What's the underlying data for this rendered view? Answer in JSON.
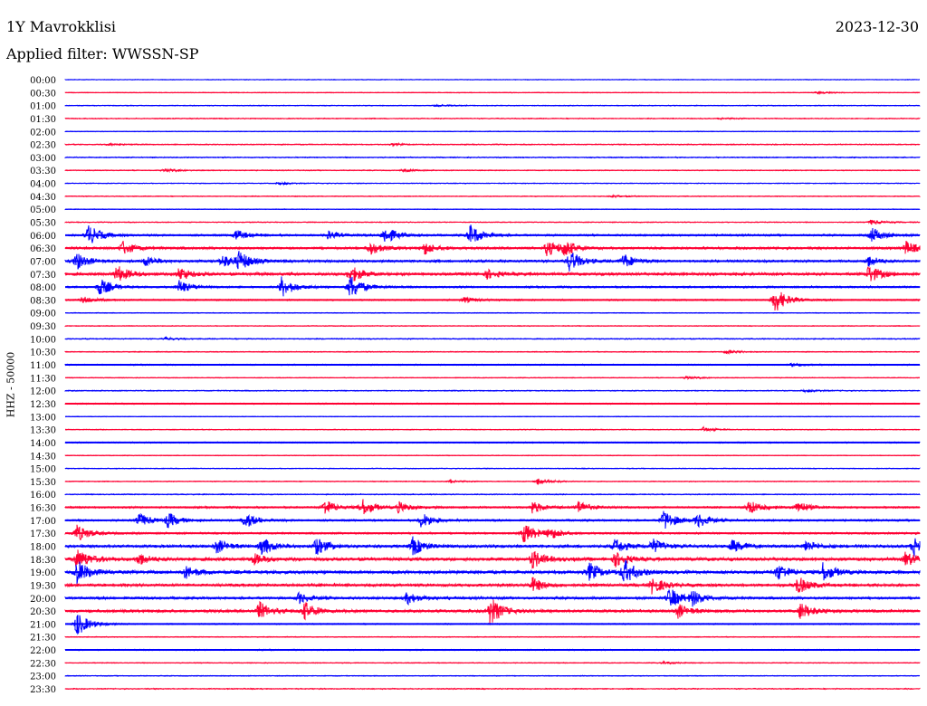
{
  "header": {
    "station": "1Y Mavrokklisi",
    "filter": "Applied filter: WWSSN-SP",
    "date": "2023-12-30"
  },
  "chart_data": {
    "type": "line",
    "title": "1Y Mavrokklisi",
    "subtitle": "Applied filter: WWSSN-SP",
    "ylabel": "HHZ - 50000",
    "xlabel": "",
    "x_range_minutes": [
      0,
      30
    ],
    "colors": {
      "even": "#0000ff",
      "odd": "#ff0033"
    },
    "rows": [
      {
        "label": "00:00",
        "base": 0.5,
        "bursts": []
      },
      {
        "label": "00:30",
        "base": 0.5,
        "bursts": [
          [
            26.4,
            1.5
          ]
        ]
      },
      {
        "label": "01:00",
        "base": 0.6,
        "bursts": [
          [
            13,
            1
          ]
        ]
      },
      {
        "label": "01:30",
        "base": 0.7,
        "bursts": [
          [
            23,
            1
          ]
        ]
      },
      {
        "label": "02:00",
        "base": 0.5,
        "bursts": []
      },
      {
        "label": "02:30",
        "base": 0.8,
        "bursts": [
          [
            1.5,
            1
          ],
          [
            11.5,
            1
          ]
        ]
      },
      {
        "label": "03:00",
        "base": 0.8,
        "bursts": []
      },
      {
        "label": "03:30",
        "base": 0.7,
        "bursts": [
          [
            3.5,
            2
          ],
          [
            11.9,
            1.5
          ]
        ]
      },
      {
        "label": "04:00",
        "base": 0.6,
        "bursts": [
          [
            7.5,
            1.5
          ]
        ]
      },
      {
        "label": "04:30",
        "base": 0.6,
        "bursts": [
          [
            19.2,
            1.5
          ]
        ]
      },
      {
        "label": "05:00",
        "base": 0.5,
        "bursts": []
      },
      {
        "label": "05:30",
        "base": 0.7,
        "bursts": [
          [
            28.3,
            3
          ]
        ]
      },
      {
        "label": "06:00",
        "base": 1.5,
        "bursts": [
          [
            0.8,
            12
          ],
          [
            6,
            6
          ],
          [
            9.2,
            5
          ],
          [
            11.2,
            10
          ],
          [
            14.2,
            12
          ],
          [
            28.3,
            9
          ]
        ]
      },
      {
        "label": "06:30",
        "base": 2,
        "bursts": [
          [
            2,
            8
          ],
          [
            10.7,
            8
          ],
          [
            12.6,
            7
          ],
          [
            16.9,
            9
          ],
          [
            17.5,
            9
          ],
          [
            29.5,
            8
          ]
        ]
      },
      {
        "label": "07:00",
        "base": 2,
        "bursts": [
          [
            0.4,
            10
          ],
          [
            2.8,
            6
          ],
          [
            5.5,
            8
          ],
          [
            6.1,
            10
          ],
          [
            17.7,
            12
          ],
          [
            19.6,
            8
          ],
          [
            28.2,
            6
          ]
        ]
      },
      {
        "label": "07:30",
        "base": 2.5,
        "bursts": [
          [
            1.8,
            10
          ],
          [
            4,
            8
          ],
          [
            10,
            10
          ],
          [
            14.8,
            5
          ],
          [
            28.2,
            10
          ]
        ]
      },
      {
        "label": "08:00",
        "base": 1.5,
        "bursts": [
          [
            1.2,
            10
          ],
          [
            4,
            8
          ],
          [
            7.6,
            12
          ],
          [
            10,
            14
          ]
        ]
      },
      {
        "label": "08:30",
        "base": 1.2,
        "bursts": [
          [
            0.6,
            4
          ],
          [
            14,
            3
          ],
          [
            24.9,
            15
          ]
        ]
      },
      {
        "label": "09:00",
        "base": 0.6,
        "bursts": []
      },
      {
        "label": "09:30",
        "base": 0.6,
        "bursts": []
      },
      {
        "label": "10:00",
        "base": 0.8,
        "bursts": [
          [
            3.5,
            1.5
          ]
        ]
      },
      {
        "label": "10:30",
        "base": 0.7,
        "bursts": [
          [
            23.2,
            2
          ]
        ]
      },
      {
        "label": "11:00",
        "base": 1,
        "bursts": [
          [
            25.5,
            2
          ]
        ]
      },
      {
        "label": "11:30",
        "base": 0.5,
        "bursts": [
          [
            21.8,
            2
          ]
        ]
      },
      {
        "label": "12:00",
        "base": 0.8,
        "bursts": [
          [
            26,
            1.5
          ]
        ]
      },
      {
        "label": "12:30",
        "base": 1,
        "bursts": []
      },
      {
        "label": "13:00",
        "base": 0.5,
        "bursts": []
      },
      {
        "label": "13:30",
        "base": 0.6,
        "bursts": [
          [
            22.4,
            2.5
          ]
        ]
      },
      {
        "label": "14:00",
        "base": 1,
        "bursts": []
      },
      {
        "label": "14:30",
        "base": 0.5,
        "bursts": []
      },
      {
        "label": "15:00",
        "base": 0.6,
        "bursts": []
      },
      {
        "label": "15:30",
        "base": 0.6,
        "bursts": [
          [
            16.6,
            4
          ],
          [
            13.5,
            1.5
          ]
        ]
      },
      {
        "label": "16:00",
        "base": 0.8,
        "bursts": []
      },
      {
        "label": "16:30",
        "base": 1.5,
        "bursts": [
          [
            9.1,
            9
          ],
          [
            10.4,
            10
          ],
          [
            11.7,
            6
          ],
          [
            16.4,
            7
          ],
          [
            18,
            7
          ],
          [
            24,
            8
          ],
          [
            25.7,
            7
          ]
        ]
      },
      {
        "label": "17:00",
        "base": 1.5,
        "bursts": [
          [
            2.6,
            8
          ],
          [
            3.6,
            8
          ],
          [
            6.3,
            9
          ],
          [
            12.5,
            9
          ],
          [
            21,
            12
          ],
          [
            22.2,
            8
          ]
        ]
      },
      {
        "label": "17:30",
        "base": 1.5,
        "bursts": [
          [
            0.4,
            10
          ],
          [
            16.1,
            12
          ],
          [
            17,
            6
          ]
        ]
      },
      {
        "label": "18:00",
        "base": 2.5,
        "bursts": [
          [
            5.3,
            8
          ],
          [
            6.9,
            10
          ],
          [
            8.8,
            10
          ],
          [
            12.2,
            10
          ],
          [
            19.3,
            8
          ],
          [
            20.6,
            8
          ],
          [
            23.4,
            7
          ],
          [
            26,
            6
          ],
          [
            29.8,
            12
          ]
        ]
      },
      {
        "label": "18:30",
        "base": 3,
        "bursts": [
          [
            0.4,
            12
          ],
          [
            2.6,
            6
          ],
          [
            6.6,
            6
          ],
          [
            16.4,
            10
          ],
          [
            19.3,
            8
          ],
          [
            29.5,
            8
          ]
        ]
      },
      {
        "label": "19:00",
        "base": 3,
        "bursts": [
          [
            0.4,
            14
          ],
          [
            4.2,
            7
          ],
          [
            18.4,
            10
          ],
          [
            19.6,
            14
          ],
          [
            25,
            9
          ],
          [
            26.6,
            10
          ]
        ]
      },
      {
        "label": "19:30",
        "base": 2.5,
        "bursts": [
          [
            16.4,
            8
          ],
          [
            20.6,
            10
          ],
          [
            25.7,
            10
          ]
        ]
      },
      {
        "label": "20:00",
        "base": 2,
        "bursts": [
          [
            8.2,
            6
          ],
          [
            12,
            7
          ],
          [
            21.2,
            12
          ],
          [
            22,
            8
          ]
        ]
      },
      {
        "label": "20:30",
        "base": 2.5,
        "bursts": [
          [
            6.8,
            10
          ],
          [
            8.4,
            10
          ],
          [
            14.9,
            16
          ],
          [
            21.5,
            8
          ],
          [
            25.8,
            10
          ]
        ]
      },
      {
        "label": "21:00",
        "base": 1,
        "bursts": [
          [
            0.4,
            14
          ]
        ]
      },
      {
        "label": "21:30",
        "base": 0.6,
        "bursts": []
      },
      {
        "label": "22:00",
        "base": 1,
        "bursts": []
      },
      {
        "label": "22:30",
        "base": 0.6,
        "bursts": [
          [
            21,
            1.5
          ]
        ]
      },
      {
        "label": "23:00",
        "base": 0.6,
        "bursts": []
      },
      {
        "label": "23:30",
        "base": 0.8,
        "bursts": []
      }
    ]
  }
}
